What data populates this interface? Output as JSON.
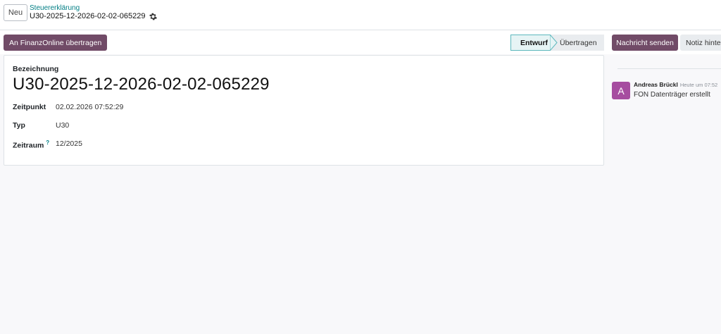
{
  "control_panel": {
    "new_button": "Neu",
    "breadcrumb": "Steuererklärung",
    "record_title": "U30-2025-12-2026-02-02-065229"
  },
  "actions": {
    "submit_finanzonline": "An FinanzOnline übertragen"
  },
  "statusbar": {
    "stages": [
      "Entwurf",
      "Übertragen"
    ],
    "active": "Entwurf"
  },
  "form": {
    "name_label": "Bezeichnung",
    "name_value": "U30-2025-12-2026-02-02-065229",
    "fields": [
      {
        "label": "Zeitpunkt",
        "value": "02.02.2026 07:52:29"
      },
      {
        "label": "Typ",
        "value": "U30"
      },
      {
        "label": "Zeitraum",
        "value": "12/2025",
        "help": "?"
      }
    ]
  },
  "chatter": {
    "send_message": "Nachricht senden",
    "log_note": "Notiz hinter",
    "messages": [
      {
        "avatar_letter": "A",
        "author": "Andreas Brückl",
        "time": "Heute um 07:52",
        "body": "FON Datenträger erstellt"
      }
    ]
  },
  "colors": {
    "brand": "#714b67",
    "link": "#017e84",
    "avatar": "#a64da0"
  }
}
